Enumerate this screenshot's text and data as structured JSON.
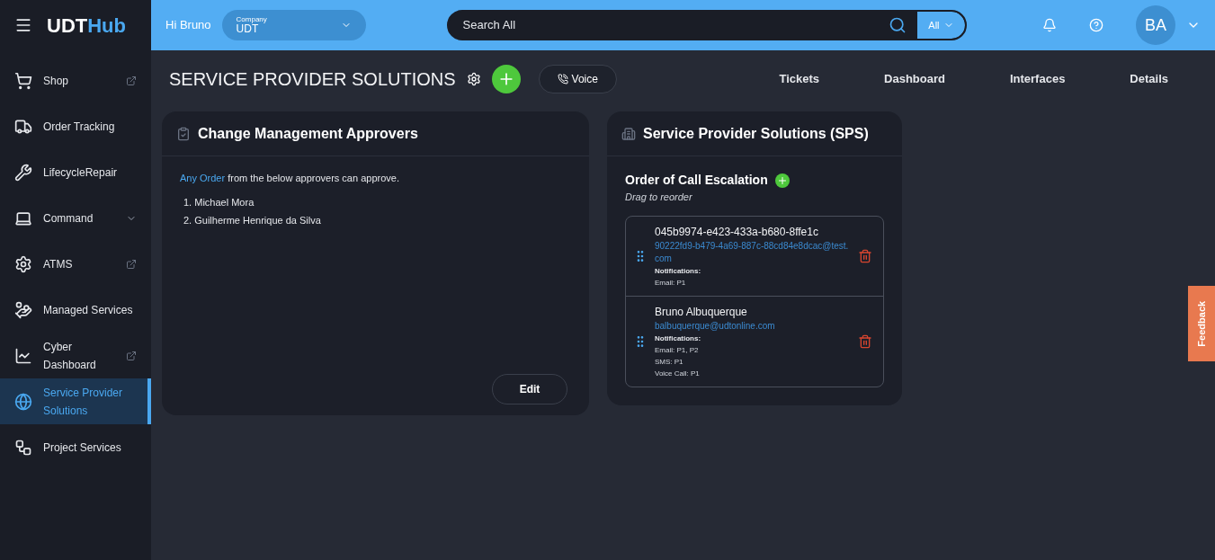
{
  "header": {
    "logo_main": "UDT",
    "logo_accent": "Hub",
    "greeting": "Hi Bruno",
    "company": {
      "label": "Company",
      "value": "UDT"
    },
    "search": {
      "placeholder": "Search All",
      "scope": "All"
    },
    "avatar": "BA"
  },
  "sidebar": {
    "items": [
      {
        "label": "Shop",
        "kind": "external",
        "selected": false
      },
      {
        "label": "Order Tracking",
        "kind": "plain",
        "selected": false
      },
      {
        "label": "LifecycleRepair",
        "kind": "plain",
        "selected": false
      },
      {
        "label": "Command",
        "kind": "menu",
        "selected": false
      },
      {
        "label": "ATMS",
        "kind": "external",
        "selected": false
      },
      {
        "label": "Managed Services",
        "kind": "plain",
        "selected": false
      },
      {
        "label": "Cyber Dashboard",
        "kind": "external",
        "selected": false
      },
      {
        "label": "Service Provider Solutions",
        "kind": "plain",
        "selected": true
      },
      {
        "label": "Project Services",
        "kind": "plain",
        "selected": false
      }
    ]
  },
  "page": {
    "title": "SERVICE PROVIDER SOLUTIONS",
    "voice_button": "Voice",
    "nav": [
      "Tickets",
      "Dashboard",
      "Interfaces",
      "Details"
    ]
  },
  "approvers_card": {
    "title": "Change Management Approvers",
    "link": "Any Order",
    "sentence_rest": " from the below approvers can approve.",
    "approvers": [
      "1. Michael Mora",
      "2. Guilherme Henrique da Silva"
    ],
    "edit_button": "Edit"
  },
  "sps_card": {
    "title": "Service Provider Solutions (SPS)",
    "section_title": "Order of Call Escalation",
    "hint": "Drag to reorder",
    "contacts": [
      {
        "name": "045b9974-e423-433a-b680-8ffe1c",
        "email": "90222fd9-b479-4a69-887c-88cd84e8dcac@test.com",
        "notifications_label": "Notifications:",
        "notifications": [
          "Email: P1"
        ]
      },
      {
        "name": "Bruno Albuquerque",
        "email": "balbuquerque@udtonline.com",
        "notifications_label": "Notifications:",
        "notifications": [
          "Email: P1, P2",
          "SMS: P1",
          "Voice Call: P1"
        ]
      }
    ]
  },
  "feedback_tab": "Feedback"
}
